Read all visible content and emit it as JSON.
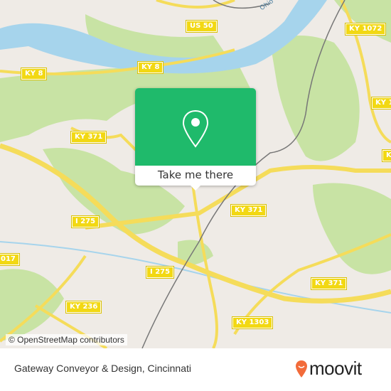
{
  "map": {
    "attribution": "© OpenStreetMap contributors",
    "river_label": "Ohio",
    "road_labels": [
      "US 50",
      "KY 1072",
      "KY 8",
      "KY 8",
      "KY 371",
      "KY 1",
      "KY 371",
      "I 275",
      "K",
      "017",
      "I 275",
      "KY 371",
      "KY 236",
      "KY 1303"
    ],
    "colors": {
      "land": "#efebe6",
      "park": "#c8e3a4",
      "water": "#a6d4ec",
      "road": "#f5dc5a",
      "popup": "#1fba6b"
    }
  },
  "popup": {
    "icon": "map-pin-icon",
    "button_label": "Take me there"
  },
  "footer": {
    "place_name": "Gateway Conveyor & Design, Cincinnati",
    "brand": "moovit",
    "brand_color": "#f26b3a"
  }
}
